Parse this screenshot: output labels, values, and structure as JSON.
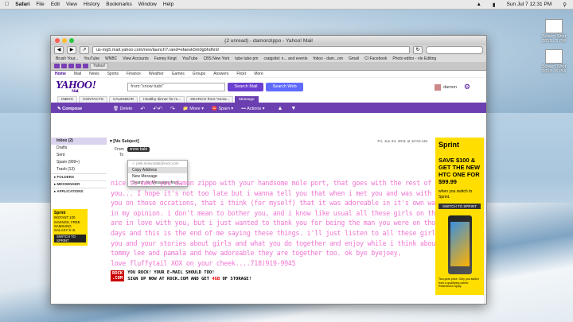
{
  "menubar": {
    "app": "Safari",
    "items": [
      "File",
      "Edit",
      "View",
      "History",
      "Bookmarks",
      "Window",
      "Help"
    ],
    "clock": "Sun Jul 7  12:31 PM"
  },
  "desktop": {
    "files": [
      {
        "label": "Screen Shot 2013...3 PM"
      },
      {
        "label": "Screen Shot 2013...5 PM"
      }
    ]
  },
  "window": {
    "title": "(2 unread) - damonzippo - Yahoo! Mail",
    "url": "us-mg5.mail.yahoo.com/neo/launch?.rand=efaesk5m0gbhdhn0",
    "bookmarks": [
      "Brush Your...",
      "YouTube",
      "WNBC",
      "View Accounts",
      "Famey Kingt",
      "YouTube",
      "CBS New York",
      "tube tube pm",
      "craigslist: n... and events",
      "fnbox - dam...om",
      "Gmail",
      "CI Facebook",
      "Photo editor - nlo Editing"
    ],
    "tabs_label": "Yahoo!"
  },
  "yahoo": {
    "nav": [
      "Home",
      "Mail",
      "News",
      "Sports",
      "Finance",
      "Weather",
      "Games",
      "Groups",
      "Answers",
      "Flickr",
      "More"
    ],
    "logo": "YAHOO!",
    "logo_sub": "Mail",
    "search_value": "from:\"snow babi\"",
    "search_mail_label": "Search Mail",
    "search_web_label": "Search Web",
    "user_name": "damon",
    "mail_tabs": [
      "INBOX",
      "CONTACTS",
      "CALENDAR",
      "Healthy dinner for m...",
      "SEARCH from:\"snow...",
      "Message"
    ],
    "compose_label": "Compose",
    "delete_label": "Delete",
    "move_label": "Move",
    "spam_label": "Spam",
    "actions_label": "Actions",
    "folders": [
      {
        "label": "Inbox (2)",
        "active": true
      },
      {
        "label": "Drafts"
      },
      {
        "label": "Sent"
      },
      {
        "label": "Spam (999+)"
      },
      {
        "label": "Trash (13)"
      }
    ],
    "folders_header": "FOLDERS",
    "messenger_header": "MESSENGER",
    "applications_header": "APPLICATIONS",
    "small_ad": {
      "brand": "Sprint",
      "text": "INSTANT 100 SAVINGS. FREE SAMSUNG GALAXY S III.",
      "cta": "SWITCH TO SPRINT"
    }
  },
  "message": {
    "subject": "[No Subject]",
    "date": "Fri, Jun 24, 2011 at 10:04 AM",
    "from_label": "From",
    "sender": "snow babi",
    "to_label": "To",
    "popup": {
      "email": "pink.snow.babi@rock.com",
      "items": [
        "Copy Address",
        "New Message",
        "Search for Messages from..."
      ]
    },
    "body_lines": [
      "nice to meet you damon zippo with your handsome mole port, that goes with the rest of",
      "you... I hope it's not too late but i wanna tell you that when i met you and was with",
      "you on those occations, that i think (for myself)  that it was adoreable in it's own way,",
      "in my opinion. i don't mean to bother you, and i know like usual all these girls on the line",
      "are in love with you, but i just wanted to thank you for being the man you were on those",
      "days and this is the end of me saying these things. i'll just listen to all these girls with",
      "you and your stories about girls and what you do together and enjoy while i think about",
      "tommy lee and pamala and how adoreable they are together too.       ok bye byejoey,",
      "love fluffytail     XOX on your cheek....718)919-9945"
    ],
    "footer_logo_top": "ROCK",
    "footer_logo_bottom": ".COM",
    "footer_line1": "YOU ROCK! YOUR E-MAIL SHOULD TOO!",
    "footer_line2_a": "SIGN UP NOW AT ROCK.COM AND GET ",
    "footer_line2_hl": "4GB",
    "footer_line2_b": " OF STORAGE!"
  },
  "right_ad": {
    "brand": "Sprint",
    "headline": "SAVE $100 & GET THE NEW HTC ONE FOR $99.99",
    "sub": "when you switch to Sprint.",
    "cta": "SWITCH TO SPRINT",
    "fine": "Two-year price. Only you switch from a qualifying carrier. Restrictions apply."
  }
}
